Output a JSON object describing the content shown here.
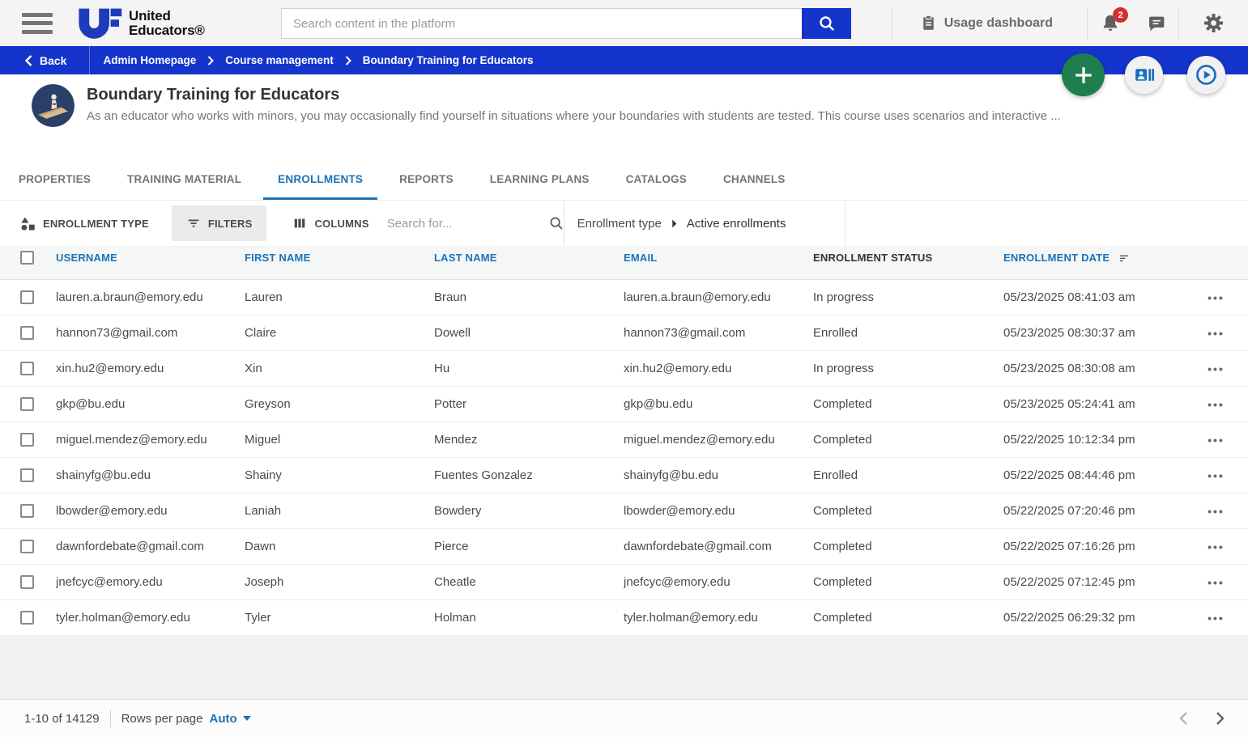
{
  "header": {
    "logo": {
      "mark": "UE",
      "line1": "United",
      "line2": "Educators®"
    },
    "search_placeholder": "Search content in the platform",
    "usage_dashboard_label": "Usage dashboard",
    "notification_count": "2"
  },
  "breadcrumb_bar": {
    "back_label": "Back",
    "items": [
      "Admin Homepage",
      "Course management",
      "Boundary Training for Educators"
    ]
  },
  "course": {
    "title": "Boundary Training for Educators",
    "description": "As an educator who works with minors, you may occasionally find yourself in situations where your boundaries with students are tested. This course uses scenarios and interactive ..."
  },
  "tabs": [
    {
      "label": "PROPERTIES",
      "active": false
    },
    {
      "label": "TRAINING MATERIAL",
      "active": false
    },
    {
      "label": "ENROLLMENTS",
      "active": true
    },
    {
      "label": "REPORTS",
      "active": false
    },
    {
      "label": "LEARNING PLANS",
      "active": false
    },
    {
      "label": "CATALOGS",
      "active": false
    },
    {
      "label": "CHANNELS",
      "active": false
    }
  ],
  "toolbar": {
    "enrollment_type_label": "ENROLLMENT TYPE",
    "filters_label": "FILTERS",
    "columns_label": "COLUMNS",
    "search_placeholder": "Search for...",
    "filter_path": {
      "parent": "Enrollment type",
      "child": "Active enrollments"
    }
  },
  "table": {
    "columns": [
      {
        "label": "USERNAME",
        "class": "link",
        "sort": false
      },
      {
        "label": "FIRST NAME",
        "class": "link",
        "sort": false
      },
      {
        "label": "LAST NAME",
        "class": "link",
        "sort": false
      },
      {
        "label": "EMAIL",
        "class": "link",
        "sort": false
      },
      {
        "label": "ENROLLMENT STATUS",
        "class": "plain",
        "sort": false
      },
      {
        "label": "ENROLLMENT DATE",
        "class": "link",
        "sort": true
      }
    ],
    "rows": [
      {
        "username": "lauren.a.braun@emory.edu",
        "first": "Lauren",
        "last": "Braun",
        "email": "lauren.a.braun@emory.edu",
        "status": "In progress",
        "date": "05/23/2025 08:41:03 am"
      },
      {
        "username": "hannon73@gmail.com",
        "first": "Claire",
        "last": "Dowell",
        "email": "hannon73@gmail.com",
        "status": "Enrolled",
        "date": "05/23/2025 08:30:37 am"
      },
      {
        "username": "xin.hu2@emory.edu",
        "first": "Xin",
        "last": "Hu",
        "email": "xin.hu2@emory.edu",
        "status": "In progress",
        "date": "05/23/2025 08:30:08 am"
      },
      {
        "username": "gkp@bu.edu",
        "first": "Greyson",
        "last": "Potter",
        "email": "gkp@bu.edu",
        "status": "Completed",
        "date": "05/23/2025 05:24:41 am"
      },
      {
        "username": "miguel.mendez@emory.edu",
        "first": "Miguel",
        "last": "Mendez",
        "email": "miguel.mendez@emory.edu",
        "status": "Completed",
        "date": "05/22/2025 10:12:34 pm"
      },
      {
        "username": "shainyfg@bu.edu",
        "first": "Shainy",
        "last": "Fuentes Gonzalez",
        "email": "shainyfg@bu.edu",
        "status": "Enrolled",
        "date": "05/22/2025 08:44:46 pm"
      },
      {
        "username": "lbowder@emory.edu",
        "first": "Laniah",
        "last": "Bowdery",
        "email": "lbowder@emory.edu",
        "status": "Completed",
        "date": "05/22/2025 07:20:46 pm"
      },
      {
        "username": "dawnfordebate@gmail.com",
        "first": "Dawn",
        "last": "Pierce",
        "email": "dawnfordebate@gmail.com",
        "status": "Completed",
        "date": "05/22/2025 07:16:26 pm"
      },
      {
        "username": "jnefcyc@emory.edu",
        "first": "Joseph",
        "last": "Cheatle",
        "email": "jnefcyc@emory.edu",
        "status": "Completed",
        "date": "05/22/2025 07:12:45 pm"
      },
      {
        "username": "tyler.holman@emory.edu",
        "first": "Tyler",
        "last": "Holman",
        "email": "tyler.holman@emory.edu",
        "status": "Completed",
        "date": "05/22/2025 06:29:32 pm"
      }
    ],
    "row_actions_icon": "ellipsis"
  },
  "footer": {
    "range": "1-10 of 14129",
    "rows_per_page_label": "Rows per page",
    "rows_per_page_value": "Auto"
  },
  "icons": {
    "hamburger": "menu-bars",
    "search": "magnifier",
    "usage": "clipboard",
    "notifications": "bell",
    "messages": "chat-bubble",
    "settings": "gear",
    "back": "chevron-left",
    "add": "plus",
    "enrollments_fab": "contact-card",
    "play_fab": "play-circle",
    "enrollment_type": "shapes",
    "filters": "filter-lines",
    "columns": "column-bars",
    "sort": "sort-lines",
    "row_menu": "ellipsis"
  },
  "colors": {
    "brand_blue": "#1434cb",
    "link_blue": "#1a73b9",
    "fab_green": "#1e7e4e",
    "badge_red": "#d32f2f",
    "header_gray": "#f4f4f4",
    "table_header_bg": "#f5f6f6"
  }
}
